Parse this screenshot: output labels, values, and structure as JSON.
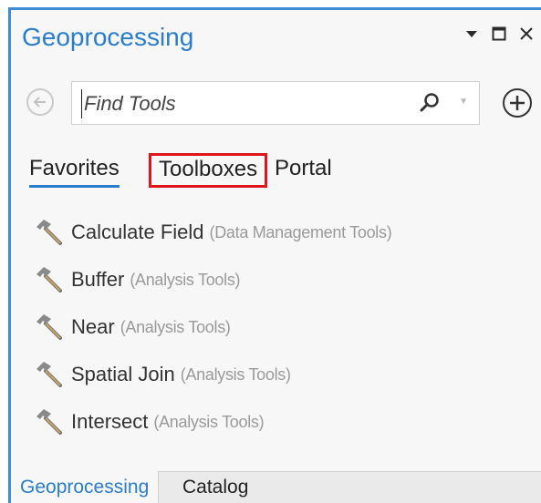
{
  "pane": {
    "title": "Geoprocessing",
    "controls": [
      "dropdown-icon",
      "maximize-icon",
      "close-icon"
    ]
  },
  "search": {
    "placeholder": "Find Tools",
    "value": ""
  },
  "tabs": [
    {
      "label": "Favorites",
      "selected": true
    },
    {
      "label": "Toolboxes",
      "highlighted": true
    },
    {
      "label": "Portal"
    }
  ],
  "tools": [
    {
      "name": "Calculate Field",
      "toolbox": "(Data Management Tools)"
    },
    {
      "name": "Buffer",
      "toolbox": "(Analysis Tools)"
    },
    {
      "name": "Near",
      "toolbox": "(Analysis Tools)"
    },
    {
      "name": "Spatial Join",
      "toolbox": "(Analysis Tools)"
    },
    {
      "name": "Intersect",
      "toolbox": "(Analysis Tools)"
    }
  ],
  "bottom_tabs": [
    {
      "label": "Geoprocessing",
      "selected": true
    },
    {
      "label": "Catalog"
    }
  ],
  "colors": {
    "accent": "#2a7ccc",
    "highlight_box": "#e0141b"
  }
}
